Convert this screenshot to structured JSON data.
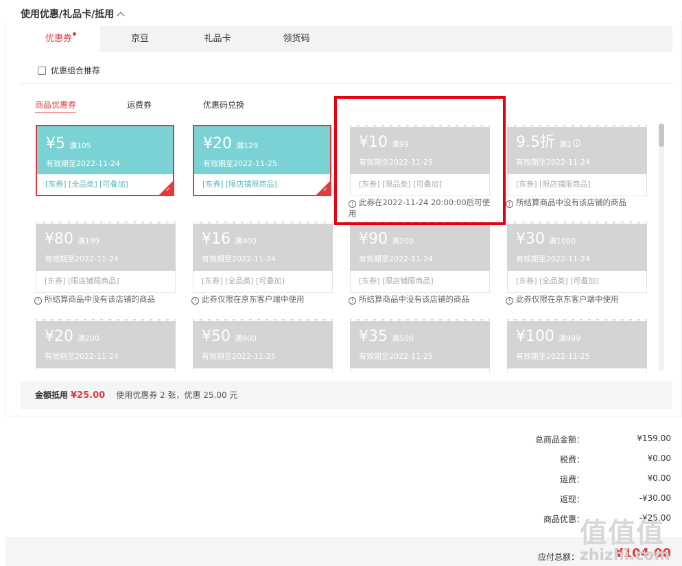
{
  "section": {
    "title": "使用优惠/礼品卡/抵用"
  },
  "tabs": [
    {
      "label": "优惠券",
      "active": true
    },
    {
      "label": "京豆",
      "active": false
    },
    {
      "label": "礼品卡",
      "active": false
    },
    {
      "label": "领货码",
      "active": false
    }
  ],
  "combo_label": "优惠组合推荐",
  "subtabs": [
    {
      "label": "商品优惠券",
      "active": true
    },
    {
      "label": "运费券",
      "active": false
    },
    {
      "label": "优惠码兑换",
      "active": false
    }
  ],
  "coupons": [
    {
      "amount": "¥5",
      "cond": "满105",
      "exp": "有效期至2022-11-24",
      "tags": "[东券]  [全品类]  [可叠加]",
      "state": "selected",
      "reason": ""
    },
    {
      "amount": "¥20",
      "cond": "满129",
      "exp": "有效期至2022-11-25",
      "tags": "[东券]  [限店铺限商品]",
      "state": "selected",
      "reason": ""
    },
    {
      "amount": "¥10",
      "cond": "满99",
      "exp": "有效期至2022-11-25",
      "tags": "[东券]  [限品类]  [可叠加]",
      "state": "disabled",
      "reason": "此券在2022-11-24 20:00:00后可使用"
    },
    {
      "amount": "9.5折",
      "cond": "满1",
      "exp": "有效期至2022-11-24",
      "tags": "[东券]  [限店铺限商品]",
      "state": "disabled",
      "reason": "所结算商品中没有该店铺的商品"
    },
    {
      "amount": "¥80",
      "cond": "满199",
      "exp": "有效期至2022-11-24",
      "tags": "[东券]  [限店铺限商品]",
      "state": "disabled",
      "reason": "所结算商品中没有该店铺的商品"
    },
    {
      "amount": "¥16",
      "cond": "满400",
      "exp": "有效期至2022-11-24",
      "tags": "[东券]  [全品类]  [可叠加]",
      "state": "disabled",
      "reason": "此券仅限在京东客户端中使用"
    },
    {
      "amount": "¥90",
      "cond": "满200",
      "exp": "有效期至2022-11-24",
      "tags": "[东券]  [限店铺限商品]",
      "state": "disabled",
      "reason": "所结算商品中没有该店铺的商品"
    },
    {
      "amount": "¥30",
      "cond": "满1000",
      "exp": "有效期至2022-11-24",
      "tags": "[东券]  [全品类]  [可叠加]",
      "state": "disabled",
      "reason": "此券仅限在京东客户端中使用"
    },
    {
      "amount": "¥20",
      "cond": "满200",
      "exp": "有效期至2022-11-24",
      "tags": "",
      "state": "disabled",
      "reason": ""
    },
    {
      "amount": "¥50",
      "cond": "满900",
      "exp": "有效期至2022-11-25",
      "tags": "",
      "state": "disabled",
      "reason": ""
    },
    {
      "amount": "¥35",
      "cond": "满500",
      "exp": "有效期至2022-11-25",
      "tags": "",
      "state": "disabled",
      "reason": ""
    },
    {
      "amount": "¥100",
      "cond": "满999",
      "exp": "有效期至2022-11-25",
      "tags": "",
      "state": "disabled",
      "reason": ""
    }
  ],
  "deduction": {
    "label": "金额抵用",
    "value": "¥25.00",
    "desc": "使用优惠券 2 张，优惠 25.00 元"
  },
  "summary": [
    {
      "label": "总商品金额：",
      "value": "¥159.00"
    },
    {
      "label": "税费：",
      "value": "¥0.00"
    },
    {
      "label": "运费：",
      "value": "¥0.00"
    },
    {
      "label": "返现：",
      "value": "-¥30.00"
    },
    {
      "label": "商品优惠：",
      "value": "-¥25.00"
    }
  ],
  "payable": {
    "label": "应付总额：",
    "value": "¥104.00"
  },
  "watermark": {
    "logo": "值值值",
    "domain": "zhizhi.com"
  },
  "colors": {
    "accent": "#e4393c",
    "coupon_available": "#7bd2d4",
    "coupon_disabled": "#d4d4d4",
    "highlight": "#e60012"
  }
}
